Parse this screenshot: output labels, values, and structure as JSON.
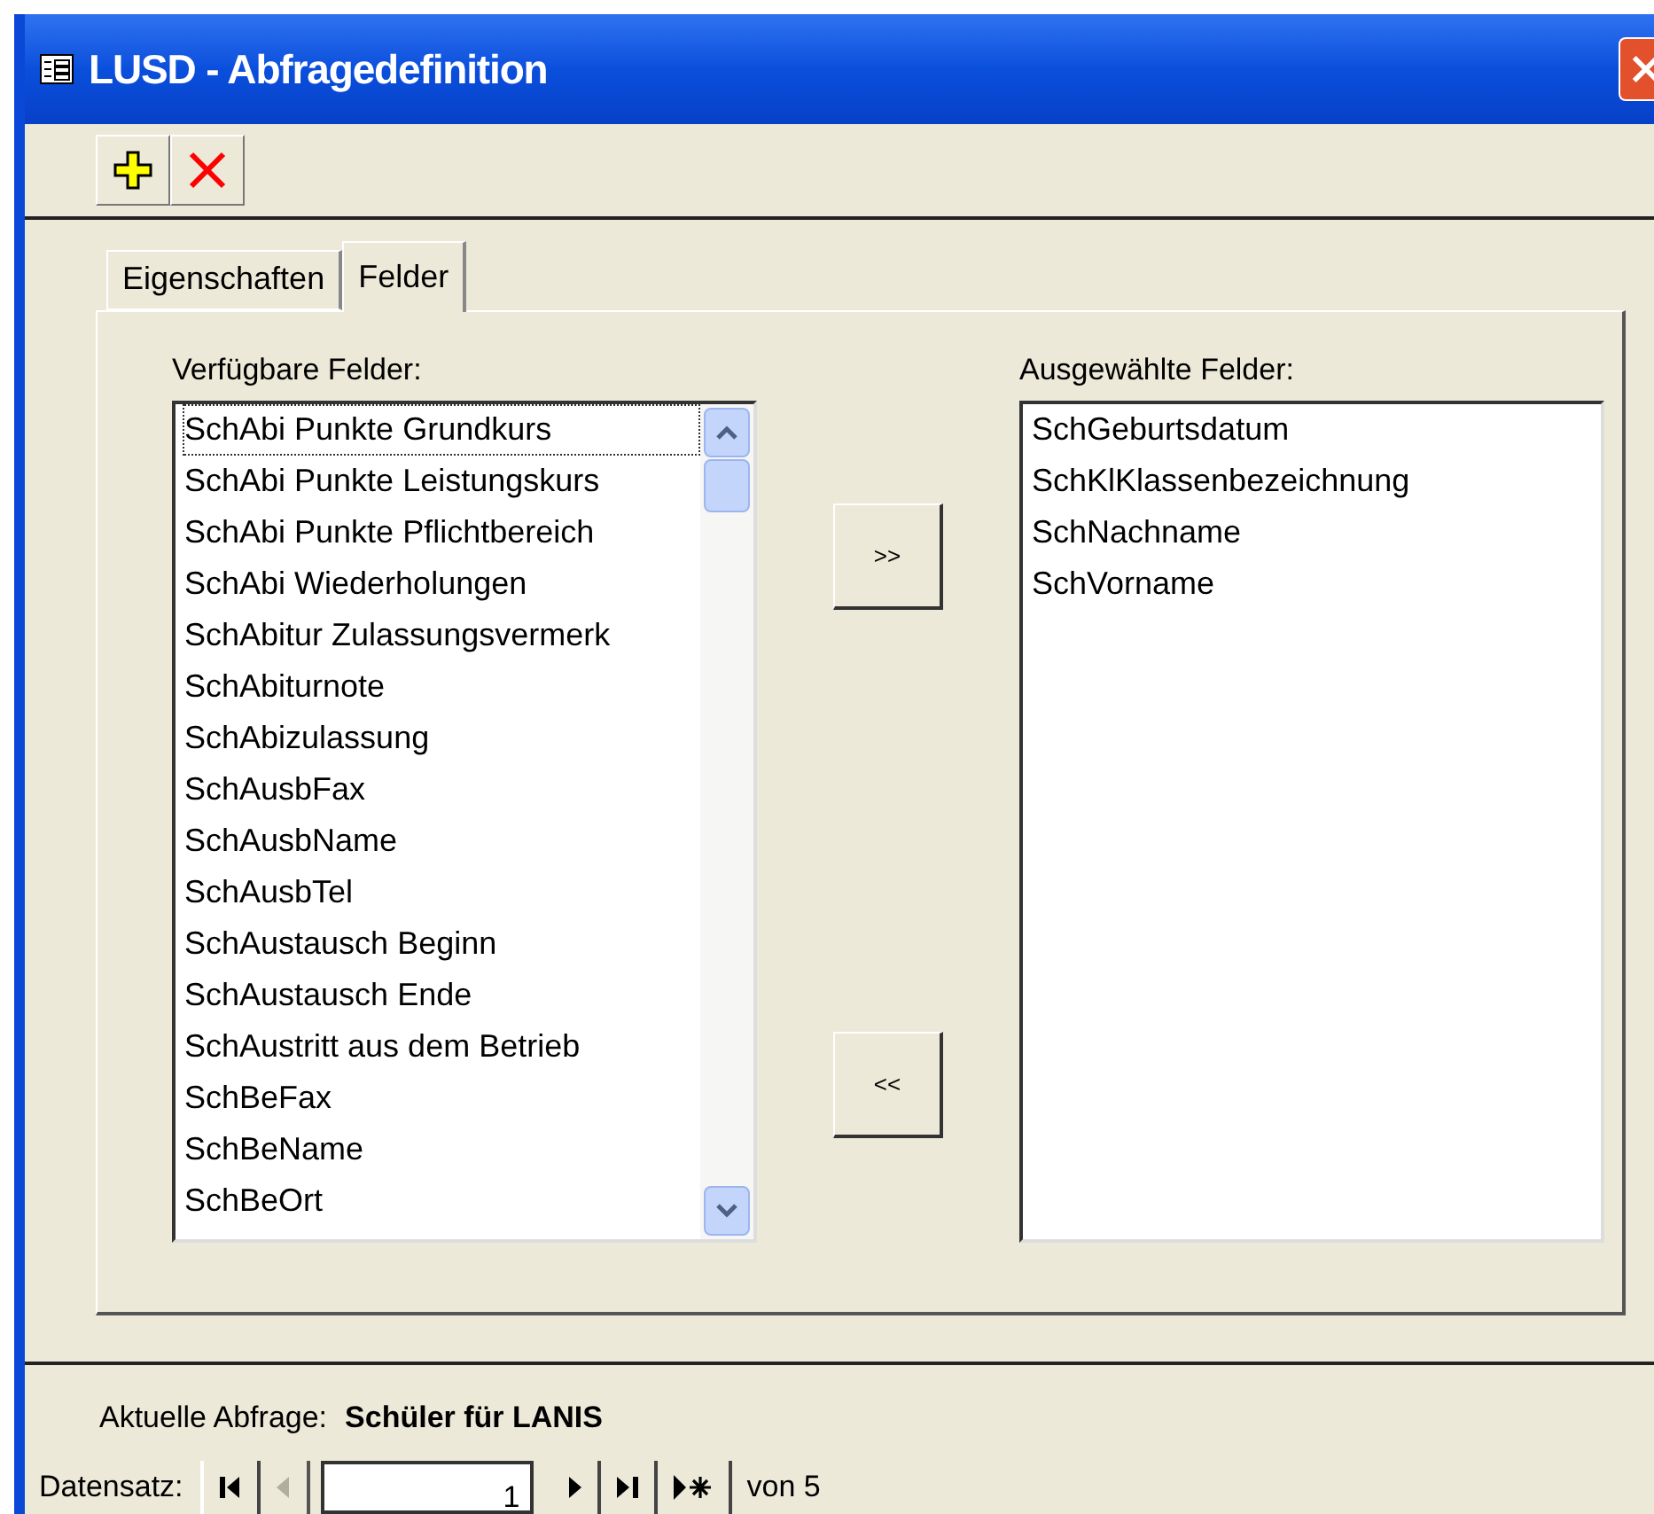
{
  "window": {
    "title": "LUSD - Abfragedefinition"
  },
  "toolbar": [
    {
      "kind": "add"
    },
    {
      "kind": "delete"
    }
  ],
  "tabs": [
    {
      "label": "Eigenschaften",
      "selected": false
    },
    {
      "label": "Felder",
      "selected": true
    }
  ],
  "available": {
    "label": "Verfügbare Felder:",
    "items": [
      {
        "label": "SchAbi Punkte Grundkurs",
        "selected": true
      },
      {
        "label": "SchAbi Punkte Leistungskurs",
        "selected": false
      },
      {
        "label": "SchAbi Punkte Pflichtbereich",
        "selected": false
      },
      {
        "label": "SchAbi Wiederholungen",
        "selected": false
      },
      {
        "label": "SchAbitur Zulassungsvermerk",
        "selected": false
      },
      {
        "label": "SchAbiturnote",
        "selected": false
      },
      {
        "label": "SchAbizulassung",
        "selected": false
      },
      {
        "label": "SchAusbFax",
        "selected": false
      },
      {
        "label": "SchAusbName",
        "selected": false
      },
      {
        "label": "SchAusbTel",
        "selected": false
      },
      {
        "label": "SchAustausch Beginn",
        "selected": false
      },
      {
        "label": "SchAustausch Ende",
        "selected": false
      },
      {
        "label": "SchAustritt aus dem Betrieb",
        "selected": false
      },
      {
        "label": "SchBeFax",
        "selected": false
      },
      {
        "label": "SchBeName",
        "selected": false
      },
      {
        "label": "SchBeOrt",
        "selected": false
      }
    ]
  },
  "move_buttons": [
    ">>",
    "<<"
  ],
  "chosen": {
    "label": "Ausgewählte Felder:",
    "items": [
      "SchGeburtsdatum",
      "SchKlKlassenbezeichnung",
      "SchNachname",
      "SchVorname"
    ]
  },
  "status": {
    "label": "Aktuelle Abfrage:",
    "value": "Schüler für LANIS"
  },
  "navigator": {
    "label": "Datensatz:",
    "buttons": [
      {
        "kind": "first",
        "disabled": false
      },
      {
        "kind": "prev",
        "disabled": true
      }
    ],
    "record": "1",
    "after": [
      {
        "kind": "next",
        "disabled": false
      },
      {
        "kind": "last",
        "disabled": false
      },
      {
        "kind": "new",
        "disabled": false
      }
    ],
    "total": "von 5"
  }
}
